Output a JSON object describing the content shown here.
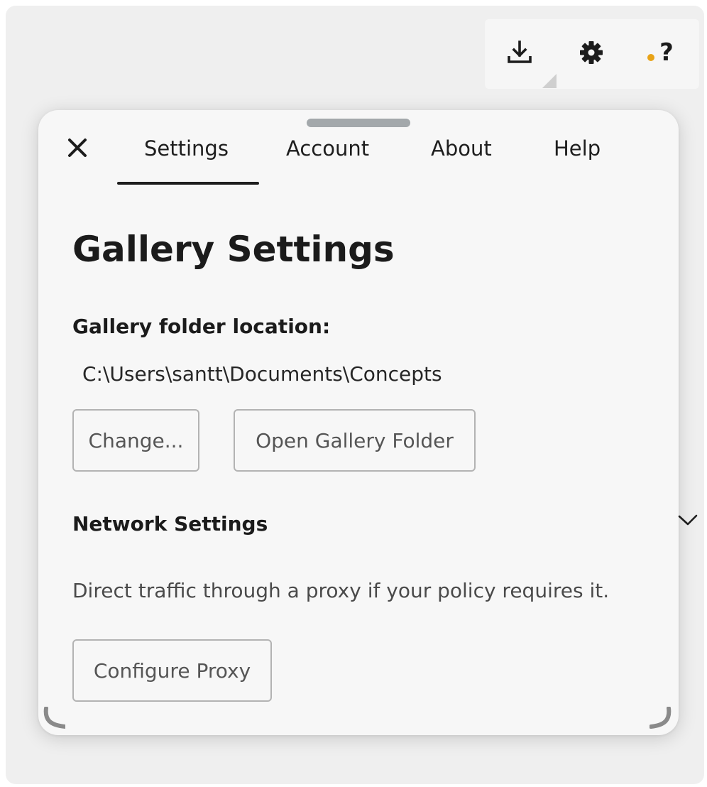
{
  "toolbar": {
    "download_icon": "download-icon",
    "settings_icon": "gear-icon",
    "help_icon": "help-icon",
    "help_text": "?",
    "help_badge_color": "#e8a317"
  },
  "panel": {
    "close_icon": "close-icon",
    "tabs": [
      {
        "label": "Settings",
        "active": true
      },
      {
        "label": "Account",
        "active": false
      },
      {
        "label": "About",
        "active": false
      },
      {
        "label": "Help",
        "active": false
      }
    ],
    "title": "Gallery Settings",
    "gallery": {
      "label": "Gallery folder location:",
      "path": "C:\\Users\\santt\\Documents\\Concepts",
      "change_button": "Change...",
      "open_button": "Open Gallery Folder"
    },
    "network": {
      "label": "Network Settings",
      "description": "Direct traffic through a proxy if your policy requires it.",
      "configure_button": "Configure Proxy",
      "expand_icon": "chevron-down-icon"
    }
  }
}
